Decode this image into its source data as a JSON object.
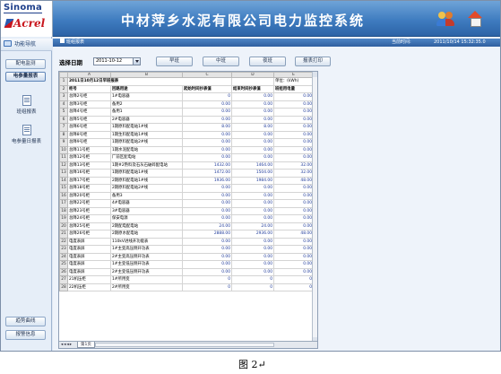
{
  "brand": {
    "logo_top": "Sinoma",
    "logo_bottom": "Acrel"
  },
  "header": {
    "title": "中材萍乡水泥有限公司电力监控系统",
    "icons": [
      "users-icon",
      "home-icon"
    ]
  },
  "sidebar": {
    "header": "功能导航",
    "buttons": {
      "monitor": "配电监测",
      "energy": "电参量报表",
      "trend": "趋势曲线",
      "alarm": "报警信息"
    },
    "sub_items": {
      "shift": "班组报表",
      "daily": "电参量日报表"
    }
  },
  "subbar": {
    "breadcrumb": "班组报表",
    "time_label": "当前时间:",
    "time_value": "2011/10/14 15:32:35.0"
  },
  "toolbar": {
    "date_label": "选择日期",
    "date_value": "2011-10-12",
    "buttons": {
      "morning": "早班",
      "middle": "中班",
      "night": "夜班",
      "print": "报表打印"
    }
  },
  "sheet": {
    "column_letters": [
      "A",
      "B",
      "C",
      "D",
      "E"
    ],
    "title": "2011日10月12日早班报表",
    "unit": "单位：(kWh)",
    "headers": [
      "柜号",
      "回路用途",
      "起始时间抄表值",
      "结束时间抄表值",
      "班组用电量"
    ],
    "rows": [
      [
        "总降2号柜",
        "1#电容器",
        "0",
        "0.00",
        "0.00"
      ],
      [
        "总降3号柜",
        "备用2",
        "0.00",
        "0.00",
        "0.00"
      ],
      [
        "总降4号柜",
        "备用1",
        "0.00",
        "0.00",
        "0.00"
      ],
      [
        "总降5号柜",
        "2#电容器",
        "0.00",
        "0.00",
        "0.00"
      ],
      [
        "总降6号柜",
        "1期原料配电站1#线",
        "8.00",
        "8.00",
        "0.00"
      ],
      [
        "总降8号柜",
        "1期生料配电站1#线",
        "0.00",
        "0.00",
        "0.00"
      ],
      [
        "总降9号柜",
        "1期原料配电站2#线",
        "0.00",
        "0.00",
        "0.00"
      ],
      [
        "总降11号柜",
        "1期水泥配电站",
        "0.00",
        "0.00",
        "0.00"
      ],
      [
        "总降12号柜",
        "厂前区配电站",
        "0.00",
        "0.00",
        "0.00"
      ],
      [
        "总降13号柜",
        "1期#2熟料及石灰石破碎配电站",
        "1432.00",
        "1464.00",
        "32.00"
      ],
      [
        "总降16号柜",
        "1期原料配电站1#线",
        "1472.00",
        "1504.00",
        "32.00"
      ],
      [
        "总降17号柜",
        "2期原料配电站1#线",
        "1936.00",
        "1984.00",
        "48.00"
      ],
      [
        "总降18号柜",
        "2期原料配电站2#线",
        "0.00",
        "0.00",
        "0.00"
      ],
      [
        "总降20号柜",
        "备用3",
        "0.00",
        "0.00",
        "0.00"
      ],
      [
        "总降22号柜",
        "4#电容器",
        "0.00",
        "0.00",
        "0.00"
      ],
      [
        "总降23号柜",
        "3#电容器",
        "0.00",
        "0.00",
        "0.00"
      ],
      [
        "总降24号柜",
        "保安电源",
        "0.00",
        "0.00",
        "0.00"
      ],
      [
        "总降25号柜",
        "2期配电配电站",
        "24.00",
        "24.00",
        "0.00"
      ],
      [
        "总降26号柜",
        "2期原水配电站",
        "2888.00",
        "2936.00",
        "48.00"
      ],
      [
        "电度表屏",
        "110kV进线开功能表",
        "0.00",
        "0.00",
        "0.00"
      ],
      [
        "电度表屏",
        "1#主变高压侧开功表",
        "0.00",
        "0.00",
        "0.00"
      ],
      [
        "电度表屏",
        "2#主变高压侧开功表",
        "0.00",
        "0.00",
        "0.00"
      ],
      [
        "电度表屏",
        "1#主变低压侧开功表",
        "0.00",
        "0.00",
        "0.00"
      ],
      [
        "电度表屏",
        "2#主变低压侧开功表",
        "0.00",
        "0.00",
        "0.00"
      ],
      [
        "21机压柜",
        "1#所用变",
        "0",
        "0",
        "0"
      ],
      [
        "22机压柜",
        "2#所用变",
        "0",
        "0",
        "0"
      ]
    ],
    "tab_name": "第1页"
  },
  "caption": "图 2↵"
}
